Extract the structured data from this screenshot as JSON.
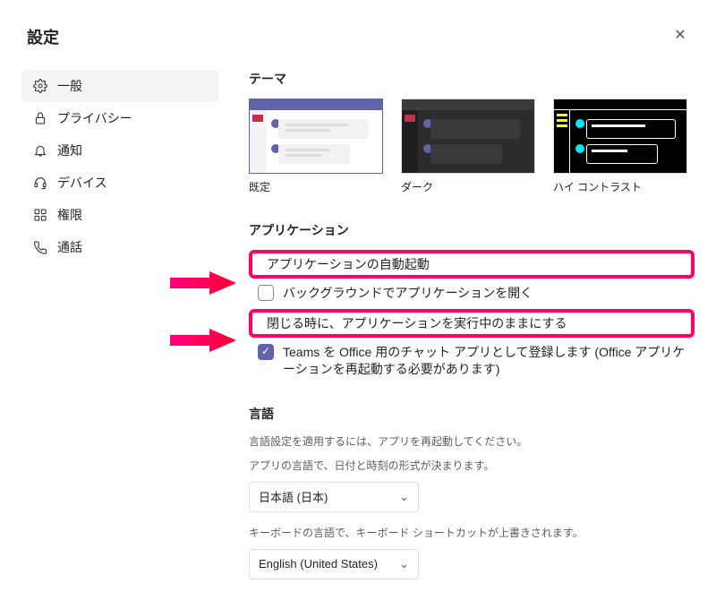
{
  "title": "設定",
  "sidebar": {
    "items": [
      {
        "label": "一般"
      },
      {
        "label": "プライバシー"
      },
      {
        "label": "通知"
      },
      {
        "label": "デバイス"
      },
      {
        "label": "権限"
      },
      {
        "label": "通話"
      }
    ]
  },
  "theme": {
    "title": "テーマ",
    "options": [
      {
        "label": "既定"
      },
      {
        "label": "ダーク"
      },
      {
        "label": "ハイ コントラスト"
      }
    ]
  },
  "application": {
    "title": "アプリケーション",
    "items": [
      {
        "label": "アプリケーションの自動起動"
      },
      {
        "label": "バックグラウンドでアプリケーションを開く"
      },
      {
        "label": "閉じる時に、アプリケーションを実行中のままにする"
      },
      {
        "label": "Teams を Office 用のチャット アプリとして登録します (Office アプリケーションを再起動する必要があります)"
      }
    ]
  },
  "language": {
    "title": "言語",
    "restart_note": "言語設定を適用するには、アプリを再起動してください。",
    "app_lang_note": "アプリの言語で、日付と時刻の形式が決まります。",
    "app_lang_value": "日本語 (日本)",
    "kb_note": "キーボードの言語で、キーボード ショートカットが上書きされます。",
    "kb_value": "English (United States)"
  }
}
